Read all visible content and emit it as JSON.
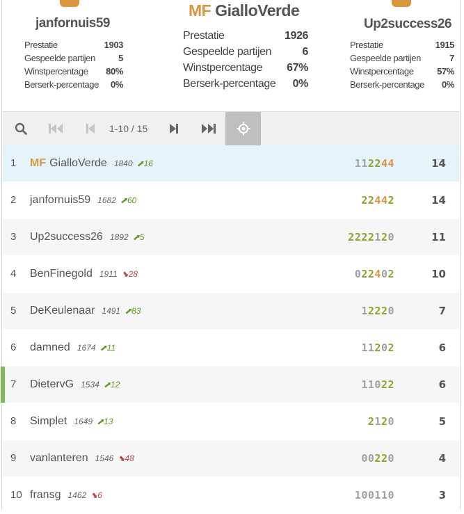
{
  "podium": {
    "second": {
      "name": "janfornuis59",
      "stats": [
        {
          "label": "Prestatie",
          "value": "1903"
        },
        {
          "label": "Gespeelde partijen",
          "value": "5"
        },
        {
          "label": "Winstpercentage",
          "value": "80%"
        },
        {
          "label": "Berserk-percentage",
          "value": "0%"
        }
      ]
    },
    "first": {
      "title": "MF",
      "name": "GialloVerde",
      "stats": [
        {
          "label": "Prestatie",
          "value": "1926"
        },
        {
          "label": "Gespeelde partijen",
          "value": "6"
        },
        {
          "label": "Winstpercentage",
          "value": "67%"
        },
        {
          "label": "Berserk-percentage",
          "value": "0%"
        }
      ]
    },
    "third": {
      "name": "Up2success26",
      "stats": [
        {
          "label": "Prestatie",
          "value": "1915"
        },
        {
          "label": "Gespeelde partijen",
          "value": "7"
        },
        {
          "label": "Winstpercentage",
          "value": "57%"
        },
        {
          "label": "Berserk-percentage",
          "value": "0%"
        }
      ]
    }
  },
  "pager": {
    "page_info": "1-10 / 15"
  },
  "standings": [
    {
      "rank": "1",
      "title": "MF",
      "name": "GialloVerde",
      "rating": "1840",
      "diff": "16",
      "dir": "up",
      "sheet": "112244",
      "score": "14",
      "me": true
    },
    {
      "rank": "2",
      "title": "",
      "name": "janfornuis59",
      "rating": "1682",
      "diff": "60",
      "dir": "up",
      "sheet": "22442",
      "score": "14"
    },
    {
      "rank": "3",
      "title": "",
      "name": "Up2success26",
      "rating": "1892",
      "diff": "5",
      "dir": "up",
      "sheet": "2222120",
      "score": "11"
    },
    {
      "rank": "4",
      "title": "",
      "name": "BenFinegold",
      "rating": "1911",
      "diff": "28",
      "dir": "down",
      "sheet": "022402",
      "score": "10"
    },
    {
      "rank": "5",
      "title": "",
      "name": "DeKeulenaar",
      "rating": "1491",
      "diff": "83",
      "dir": "up",
      "sheet": "12220",
      "score": "7"
    },
    {
      "rank": "6",
      "title": "",
      "name": "damned",
      "rating": "1674",
      "diff": "11",
      "dir": "up",
      "sheet": "11202",
      "score": "6"
    },
    {
      "rank": "7",
      "title": "",
      "name": "DietervG",
      "rating": "1534",
      "diff": "12",
      "dir": "up",
      "sheet": "11022",
      "score": "6",
      "active": true
    },
    {
      "rank": "8",
      "title": "",
      "name": "Simplet",
      "rating": "1649",
      "diff": "13",
      "dir": "up",
      "sheet": "2120",
      "score": "5"
    },
    {
      "rank": "9",
      "title": "",
      "name": "vanlanteren",
      "rating": "1546",
      "diff": "48",
      "dir": "down",
      "sheet": "00220",
      "score": "4"
    },
    {
      "rank": "10",
      "title": "",
      "name": "fransg",
      "rating": "1462",
      "diff": "6",
      "dir": "down",
      "sheet": "100110",
      "score": "3"
    }
  ],
  "colors": {
    "accent": "#d9963d",
    "win": "#8ca52f",
    "up": "#629924",
    "down": "#b54a4a",
    "me_row": "#e5f3fa",
    "active_marker": "#7fba5a"
  }
}
